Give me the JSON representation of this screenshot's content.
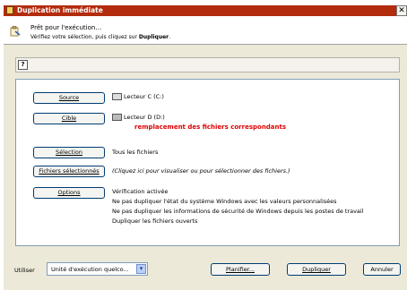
{
  "window": {
    "title": "Duplication immédiate",
    "close_glyph": "✕"
  },
  "header": {
    "title": "Prêt pour l'exécution…",
    "subtitle_prefix": "Vérifiez votre sélection, puis cliquez sur ",
    "subtitle_bold": "Dupliquer",
    "subtitle_suffix": "."
  },
  "toolbar": {
    "help_glyph": "?"
  },
  "rows": {
    "source": {
      "button": "Source",
      "text": "Lecteur C (C:)"
    },
    "target": {
      "button": "Cible",
      "text": "Lecteur D (D:)",
      "warning": "remplacement des fichiers correspondants"
    },
    "selection": {
      "button": "Sélection",
      "text": "Tous les fichiers"
    },
    "selected_files": {
      "button": "Fichiers sélectionnés",
      "text": "(Cliquez ici pour visualiser ou pour sélectionner des fichiers.)"
    },
    "options": {
      "button": "Options",
      "lines": [
        "Vérification activée",
        "Ne pas dupliquer l'état du système Windows avec les valeurs personnalisées",
        "Ne pas dupliquer les informations de sécurité de Windows depuis les postes de travail",
        "Dupliquer les fichiers ouverts"
      ]
    }
  },
  "footer": {
    "use_label": "Utiliser",
    "select_value": "Unité d'exécution quelco...",
    "schedule_button": "Planifier...",
    "duplicate_button": "Dupliquer",
    "cancel_button": "Annuler"
  },
  "colors": {
    "titlebar": "#b22c0d",
    "warning": "#e00000",
    "dialog_bg": "#ece9d8"
  }
}
